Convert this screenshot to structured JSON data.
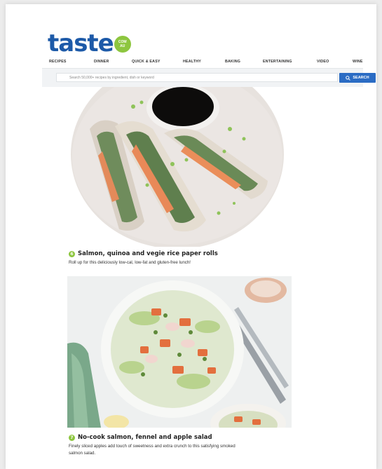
{
  "logo": {
    "word": "taste",
    "badge_line1": "COM",
    "badge_line2": "AU"
  },
  "nav": {
    "items": [
      "RECIPES",
      "DINNER",
      "QUICK & EASY",
      "HEALTHY",
      "BAKING",
      "ENTERTAINING",
      "VIDEO",
      "WINE"
    ]
  },
  "search": {
    "placeholder": "Search 50,000+ recipes by ingredient, dish or keyword",
    "button_label": "SEARCH"
  },
  "recipes": [
    {
      "number": "6",
      "title": "Salmon, quinoa and vegie rice paper rolls",
      "description": "Roll up for this deliciously low-cal, low-fat and gluten-free lunch!"
    },
    {
      "number": "7",
      "title": "No-cook salmon, fennel and apple salad",
      "description_line1": "Finely sliced apples add touch of sweetness and extra crunch to this satisfying smoked",
      "description_line2": "salmon salad."
    }
  ],
  "colors": {
    "brand_blue": "#1d5aa8",
    "brand_green": "#8dc63f",
    "search_button": "#2b6cc4"
  }
}
